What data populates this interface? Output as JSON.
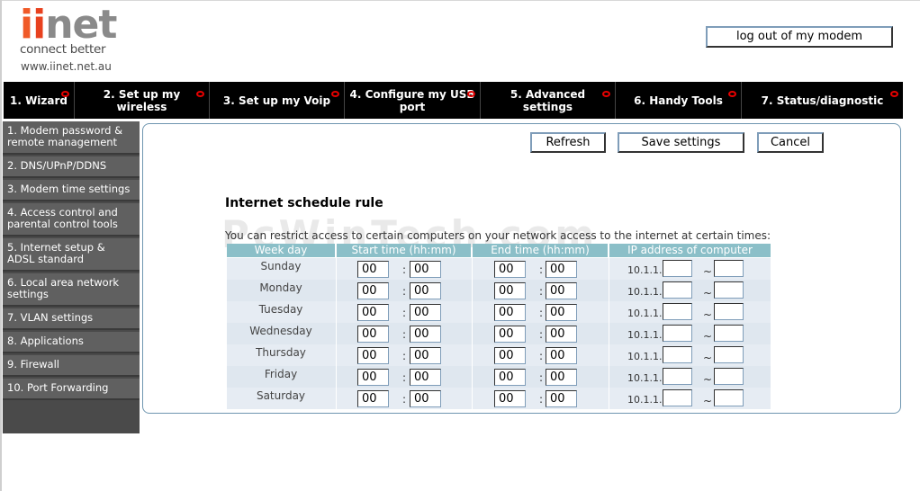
{
  "brand": {
    "logo_text_i1": "i",
    "logo_text_i2": "i",
    "logo_text_net": "net",
    "tagline": "connect better",
    "url": "www.iinet.net.au",
    "colors": {
      "orange": "#f05a28",
      "grey": "#8a8a8a",
      "nav_bg": "#000000",
      "sidebar_bg": "#606060",
      "table_head": "#8bbfc8"
    }
  },
  "header": {
    "logout_label": "log out of my modem"
  },
  "topnav": [
    {
      "label": "1. Wizard"
    },
    {
      "label": "2. Set up my wireless"
    },
    {
      "label": "3. Set up my Voip"
    },
    {
      "label": "4. Configure my USB port"
    },
    {
      "label": "5. Advanced settings"
    },
    {
      "label": "6. Handy Tools"
    },
    {
      "label": "7. Status/diagnostic"
    }
  ],
  "sidebar": [
    {
      "label": "1. Modem password & remote management"
    },
    {
      "label": "2. DNS/UPnP/DDNS"
    },
    {
      "label": "3. Modem time settings"
    },
    {
      "label": "4. Access control and parental control tools"
    },
    {
      "label": "5. Internet setup & ADSL standard"
    },
    {
      "label": "6. Local area network settings"
    },
    {
      "label": "7. VLAN settings"
    },
    {
      "label": "8. Applications"
    },
    {
      "label": "9. Firewall"
    },
    {
      "label": "10. Port Forwarding"
    }
  ],
  "toolbar": {
    "refresh_label": "Refresh",
    "save_label": "Save settings",
    "cancel_label": "Cancel"
  },
  "schedule": {
    "title": "Internet schedule rule",
    "description": "You can restrict access to certain computers on your network access to the internet at certain times:",
    "watermark": "PcWinTech.com",
    "columns": [
      "Week day",
      "Start time (hh:mm)",
      "End time (hh:mm)",
      "IP address of computer"
    ],
    "ip_prefix": "10.1.1.",
    "range_sep": "~",
    "time_sep": ":",
    "rows": [
      {
        "day": "Sunday",
        "start_h": "00",
        "start_m": "00",
        "end_h": "00",
        "end_m": "00",
        "ip_from": "",
        "ip_to": ""
      },
      {
        "day": "Monday",
        "start_h": "00",
        "start_m": "00",
        "end_h": "00",
        "end_m": "00",
        "ip_from": "",
        "ip_to": ""
      },
      {
        "day": "Tuesday",
        "start_h": "00",
        "start_m": "00",
        "end_h": "00",
        "end_m": "00",
        "ip_from": "",
        "ip_to": ""
      },
      {
        "day": "Wednesday",
        "start_h": "00",
        "start_m": "00",
        "end_h": "00",
        "end_m": "00",
        "ip_from": "",
        "ip_to": ""
      },
      {
        "day": "Thursday",
        "start_h": "00",
        "start_m": "00",
        "end_h": "00",
        "end_m": "00",
        "ip_from": "",
        "ip_to": ""
      },
      {
        "day": "Friday",
        "start_h": "00",
        "start_m": "00",
        "end_h": "00",
        "end_m": "00",
        "ip_from": "",
        "ip_to": ""
      },
      {
        "day": "Saturday",
        "start_h": "00",
        "start_m": "00",
        "end_h": "00",
        "end_m": "00",
        "ip_from": "",
        "ip_to": ""
      }
    ]
  }
}
